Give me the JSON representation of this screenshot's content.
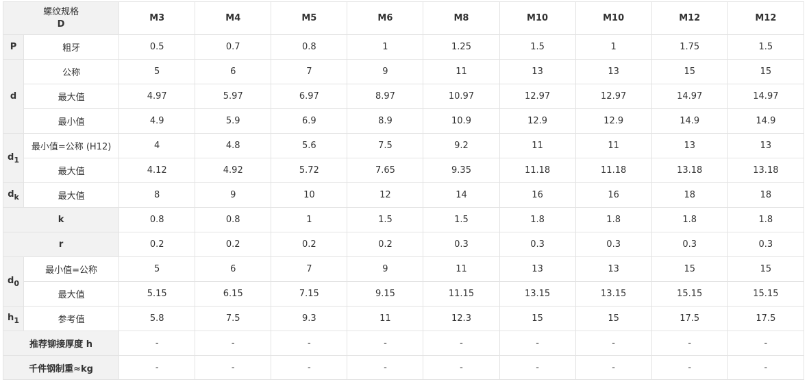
{
  "header": {
    "corner_line1": "螺纹规格",
    "corner_line2": "D",
    "sizes": [
      "M3",
      "M4",
      "M5",
      "M6",
      "M8",
      "M10",
      "M10",
      "M12",
      "M12"
    ]
  },
  "rows": {
    "p": {
      "symbol": "P",
      "label": "粗牙",
      "values": [
        "0.5",
        "0.7",
        "0.8",
        "1",
        "1.25",
        "1.5",
        "1",
        "1.75",
        "1.5"
      ]
    },
    "d_nom": {
      "symbol": "d",
      "label": "公称",
      "values": [
        "5",
        "6",
        "7",
        "9",
        "11",
        "13",
        "13",
        "15",
        "15"
      ]
    },
    "d_max": {
      "label": "最大值",
      "values": [
        "4.97",
        "5.97",
        "6.97",
        "8.97",
        "10.97",
        "12.97",
        "12.97",
        "14.97",
        "14.97"
      ]
    },
    "d_min": {
      "label": "最小值",
      "values": [
        "4.9",
        "5.9",
        "6.9",
        "8.9",
        "10.9",
        "12.9",
        "12.9",
        "14.9",
        "14.9"
      ]
    },
    "d1_min": {
      "symbol_base": "d",
      "symbol_sub": "1",
      "label": "最小值=公称 (H12)",
      "values": [
        "4",
        "4.8",
        "5.6",
        "7.5",
        "9.2",
        "11",
        "11",
        "13",
        "13"
      ]
    },
    "d1_max": {
      "label": "最大值",
      "values": [
        "4.12",
        "4.92",
        "5.72",
        "7.65",
        "9.35",
        "11.18",
        "11.18",
        "13.18",
        "13.18"
      ]
    },
    "dk_max": {
      "symbol_base": "d",
      "symbol_sub": "k",
      "label": "最大值",
      "values": [
        "8",
        "9",
        "10",
        "12",
        "14",
        "16",
        "16",
        "18",
        "18"
      ]
    },
    "k": {
      "symbol": "k",
      "values": [
        "0.8",
        "0.8",
        "1",
        "1.5",
        "1.5",
        "1.8",
        "1.8",
        "1.8",
        "1.8"
      ]
    },
    "r": {
      "symbol": "r",
      "values": [
        "0.2",
        "0.2",
        "0.2",
        "0.2",
        "0.3",
        "0.3",
        "0.3",
        "0.3",
        "0.3"
      ]
    },
    "d0_min": {
      "symbol_base": "d",
      "symbol_sub": "0",
      "label": "最小值=公称",
      "values": [
        "5",
        "6",
        "7",
        "9",
        "11",
        "13",
        "13",
        "15",
        "15"
      ]
    },
    "d0_max": {
      "label": "最大值",
      "values": [
        "5.15",
        "6.15",
        "7.15",
        "9.15",
        "11.15",
        "13.15",
        "13.15",
        "15.15",
        "15.15"
      ]
    },
    "h1_ref": {
      "symbol_base": "h",
      "symbol_sub": "1",
      "label": "参考值",
      "values": [
        "5.8",
        "7.5",
        "9.3",
        "11",
        "12.3",
        "15",
        "15",
        "17.5",
        "17.5"
      ]
    },
    "rivet": {
      "label": "推荐铆接厚度 h",
      "values": [
        "-",
        "-",
        "-",
        "-",
        "-",
        "-",
        "-",
        "-",
        "-"
      ]
    },
    "weight": {
      "label": "千件钢制重≈kg",
      "values": [
        "-",
        "-",
        "-",
        "-",
        "-",
        "-",
        "-",
        "-",
        "-"
      ]
    }
  }
}
